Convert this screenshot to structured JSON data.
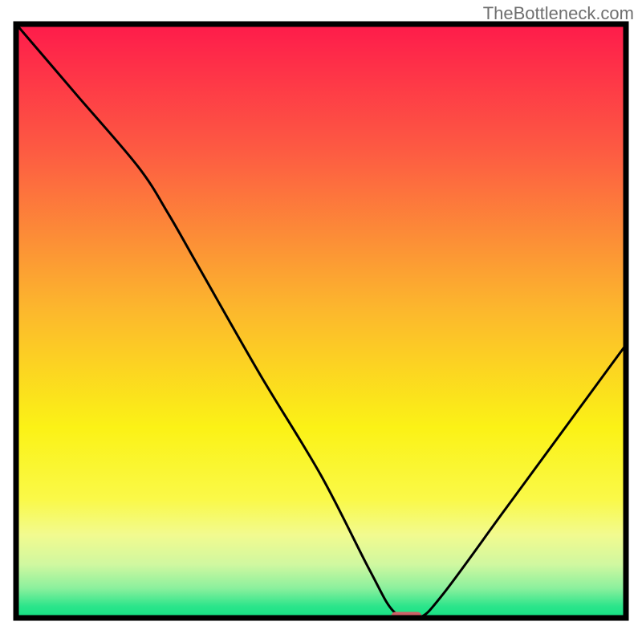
{
  "watermark": "TheBottleneck.com",
  "chart_data": {
    "type": "line",
    "title": "",
    "xlabel": "",
    "ylabel": "",
    "xlim": [
      0,
      100
    ],
    "ylim": [
      0,
      100
    ],
    "grid": false,
    "legend": false,
    "series": [
      {
        "name": "bottleneck-curve",
        "x": [
          0,
          10,
          20,
          25,
          30,
          40,
          50,
          58,
          62,
          66,
          70,
          80,
          90,
          100
        ],
        "y": [
          100,
          88,
          76,
          68,
          59,
          41,
          24,
          8,
          1,
          0,
          4,
          18,
          32,
          46
        ],
        "color": "#000000"
      }
    ],
    "marker": {
      "x": 64,
      "y": 0,
      "width": 5,
      "height": 1.5,
      "color": "#cf6168"
    },
    "background_gradient": {
      "type": "vertical",
      "stops": [
        {
          "offset": 0,
          "color": "#fe1b4b"
        },
        {
          "offset": 22,
          "color": "#fd5d42"
        },
        {
          "offset": 48,
          "color": "#fcb72d"
        },
        {
          "offset": 68,
          "color": "#fbf216"
        },
        {
          "offset": 80,
          "color": "#faf948"
        },
        {
          "offset": 86,
          "color": "#f2fa8f"
        },
        {
          "offset": 91,
          "color": "#d0f8a0"
        },
        {
          "offset": 95,
          "color": "#8bf09d"
        },
        {
          "offset": 98,
          "color": "#2de58b"
        },
        {
          "offset": 100,
          "color": "#12e184"
        }
      ]
    },
    "plot_border_color": "#000000"
  }
}
